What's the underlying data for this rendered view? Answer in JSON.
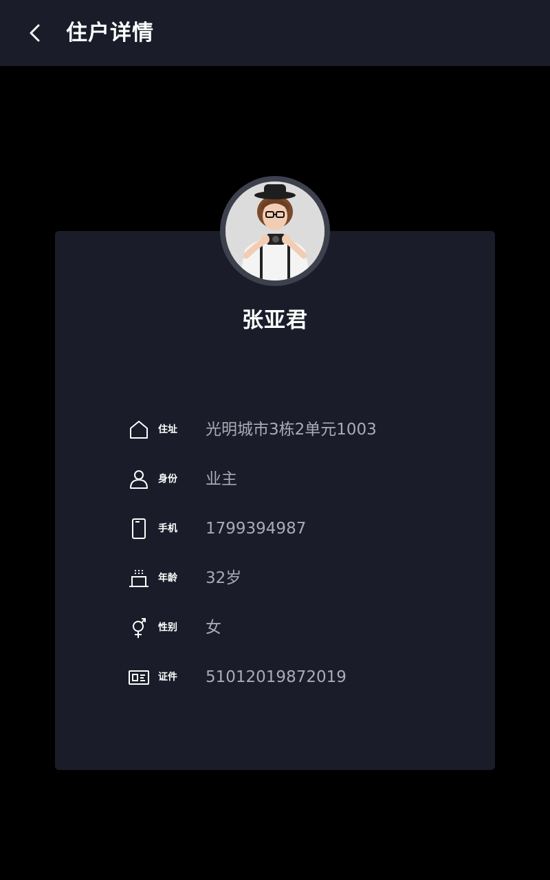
{
  "header": {
    "title": "住户详情",
    "back_icon": "chevron-left-icon"
  },
  "profile": {
    "name": "张亚君",
    "avatar": "avatar-photo-woman-with-camera"
  },
  "details": [
    {
      "icon": "house-icon",
      "label": "住址",
      "value": "光明城市3栋2单元1003"
    },
    {
      "icon": "person-icon",
      "label": "身份",
      "value": "业主"
    },
    {
      "icon": "phone-icon",
      "label": "手机",
      "value": "1799394987"
    },
    {
      "icon": "cake-icon",
      "label": "年龄",
      "value": "32岁"
    },
    {
      "icon": "gender-icon",
      "label": "性别",
      "value": "女"
    },
    {
      "icon": "id-card-icon",
      "label": "证件",
      "value": "51012019872019"
    }
  ],
  "colors": {
    "background": "#000000",
    "surface": "#1a1d29",
    "text_primary": "#ffffff",
    "text_secondary": "#a9acb6",
    "avatar_ring": "#3d414d"
  }
}
